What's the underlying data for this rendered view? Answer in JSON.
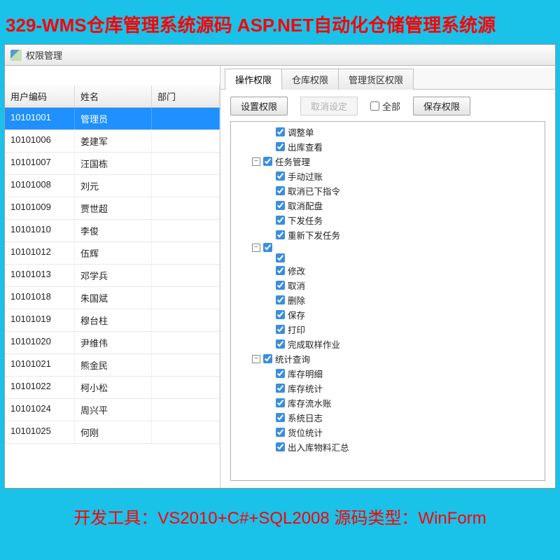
{
  "banner_top": "329-WMS仓库管理系统源码 ASP.NET自动化仓储管理系统源",
  "banner_bottom": "开发工具：VS2010+C#+SQL2008  源码类型：WinForm",
  "window_title": "权限管理",
  "grid": {
    "headers": {
      "code": "用户编码",
      "name": "姓名",
      "dept": "部门"
    },
    "rows": [
      {
        "code": "10101001",
        "name": "管理员",
        "dept": "",
        "selected": true
      },
      {
        "code": "10101006",
        "name": "姜建军",
        "dept": ""
      },
      {
        "code": "10101007",
        "name": "汪国栋",
        "dept": ""
      },
      {
        "code": "10101008",
        "name": "刘元",
        "dept": ""
      },
      {
        "code": "10101009",
        "name": "贾世超",
        "dept": ""
      },
      {
        "code": "10101010",
        "name": "李俊",
        "dept": ""
      },
      {
        "code": "10101012",
        "name": "伍辉",
        "dept": ""
      },
      {
        "code": "10101013",
        "name": "邓学兵",
        "dept": ""
      },
      {
        "code": "10101018",
        "name": "朱国斌",
        "dept": ""
      },
      {
        "code": "10101019",
        "name": "穆台柱",
        "dept": ""
      },
      {
        "code": "10101020",
        "name": "尹维伟",
        "dept": ""
      },
      {
        "code": "10101021",
        "name": "熊金民",
        "dept": ""
      },
      {
        "code": "10101022",
        "name": "柯小松",
        "dept": ""
      },
      {
        "code": "10101024",
        "name": "周兴平",
        "dept": ""
      },
      {
        "code": "10101025",
        "name": "何刚",
        "dept": ""
      }
    ]
  },
  "tabs": [
    "操作权限",
    "仓库权限",
    "管理货区权限"
  ],
  "toolbar": {
    "set": "设置权限",
    "cancel": "取消设定",
    "all": "全部",
    "save": "保存权限"
  },
  "tree": [
    {
      "level": 1,
      "toggle": "",
      "checked": true,
      "label": "调整单"
    },
    {
      "level": 1,
      "toggle": "",
      "checked": true,
      "label": "出库查看"
    },
    {
      "level": 0,
      "toggle": "-",
      "checked": true,
      "label": "任务管理"
    },
    {
      "level": 1,
      "toggle": "",
      "checked": true,
      "label": "手动过账"
    },
    {
      "level": 1,
      "toggle": "",
      "checked": true,
      "label": "取消已下指令"
    },
    {
      "level": 1,
      "toggle": "",
      "checked": true,
      "label": "取消配盘"
    },
    {
      "level": 1,
      "toggle": "",
      "checked": true,
      "label": "下发任务"
    },
    {
      "level": 1,
      "toggle": "",
      "checked": true,
      "label": "重新下发任务"
    },
    {
      "level": 0,
      "toggle": "-",
      "checked": true,
      "label": ""
    },
    {
      "level": 1,
      "toggle": "",
      "checked": true,
      "label": ""
    },
    {
      "level": 1,
      "toggle": "",
      "checked": true,
      "label": "修改"
    },
    {
      "level": 1,
      "toggle": "",
      "checked": true,
      "label": "取消"
    },
    {
      "level": 1,
      "toggle": "",
      "checked": true,
      "label": "删除"
    },
    {
      "level": 1,
      "toggle": "",
      "checked": true,
      "label": "保存"
    },
    {
      "level": 1,
      "toggle": "",
      "checked": true,
      "label": "打印"
    },
    {
      "level": 1,
      "toggle": "",
      "checked": true,
      "label": "完成取样作业"
    },
    {
      "level": 0,
      "toggle": "-",
      "checked": true,
      "label": "统计查询"
    },
    {
      "level": 1,
      "toggle": "",
      "checked": true,
      "label": "库存明细"
    },
    {
      "level": 1,
      "toggle": "",
      "checked": true,
      "label": "库存统计"
    },
    {
      "level": 1,
      "toggle": "",
      "checked": true,
      "label": "库存流水账"
    },
    {
      "level": 1,
      "toggle": "",
      "checked": true,
      "label": "系统日志"
    },
    {
      "level": 1,
      "toggle": "",
      "checked": true,
      "label": "货位统计"
    },
    {
      "level": 1,
      "toggle": "",
      "checked": true,
      "label": "出入库物料汇总"
    }
  ]
}
